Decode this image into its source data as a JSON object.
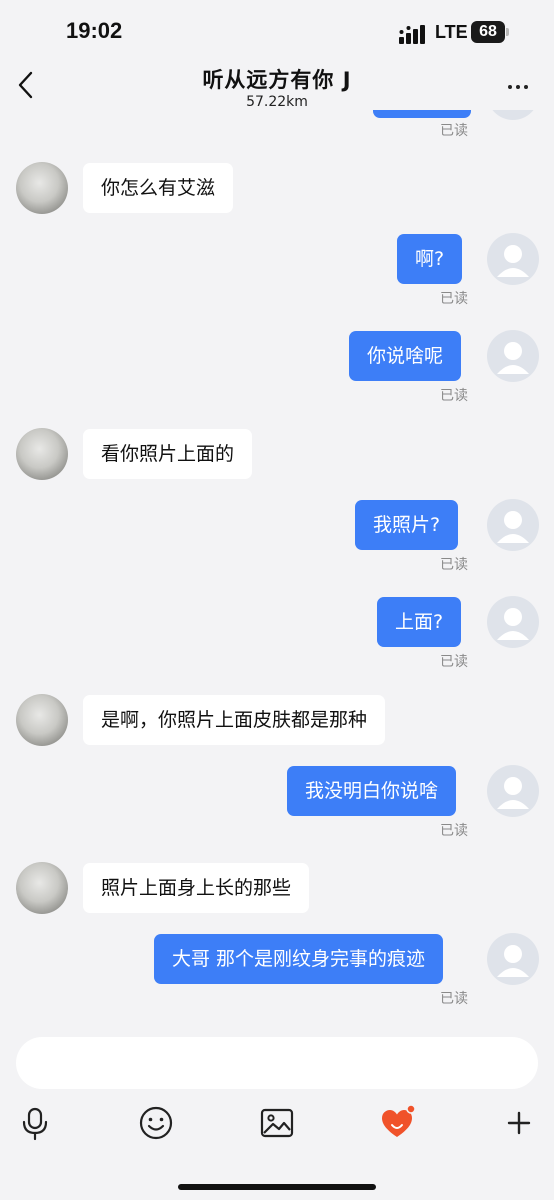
{
  "status_bar": {
    "time": "19:02",
    "network": "LTE",
    "battery": "68"
  },
  "header": {
    "title": "听从远方有你 J",
    "subtitle": "57.22km"
  },
  "read_label": "已读",
  "messages": [
    {
      "side": "in",
      "text": "你怎么有艾滋"
    },
    {
      "side": "out",
      "text": "啊?",
      "status": "已读"
    },
    {
      "side": "out",
      "text": "你说啥呢",
      "status": "已读"
    },
    {
      "side": "in",
      "text": "看你照片上面的"
    },
    {
      "side": "out",
      "text": "我照片?",
      "status": "已读"
    },
    {
      "side": "out",
      "text": "上面?",
      "status": "已读"
    },
    {
      "side": "in",
      "text": "是啊，你照片上面皮肤都是那种"
    },
    {
      "side": "out",
      "text": "我没明白你说啥",
      "status": "已读"
    },
    {
      "side": "in",
      "text": "照片上面身上长的那些"
    },
    {
      "side": "out",
      "text": "大哥 那个是刚纹身完事的痕迹",
      "status": "已读"
    }
  ],
  "input": {
    "value": "",
    "placeholder": ""
  },
  "toolbar": {
    "icons": [
      "microphone-icon",
      "emoji-icon",
      "image-icon",
      "gift-heart-icon",
      "plus-icon"
    ]
  },
  "colors": {
    "outgoing_bubble": "#3d7ef7",
    "incoming_bubble": "#ffffff",
    "background": "#f3f3f5",
    "read_text": "#8a8a8a",
    "gift_accent": "#f0522a"
  }
}
